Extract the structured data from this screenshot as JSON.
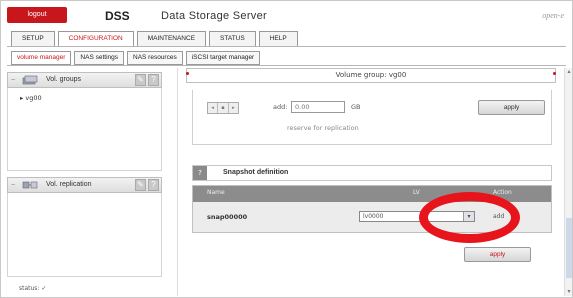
{
  "header": {
    "logout_label": "logout",
    "brand": "DSS",
    "brand_subtitle": "Data Storage Server",
    "vendor": "open-e"
  },
  "main_tabs": [
    {
      "label": "SETUP",
      "active": false
    },
    {
      "label": "CONFIGURATION",
      "active": true
    },
    {
      "label": "MAINTENANCE",
      "active": false
    },
    {
      "label": "STATUS",
      "active": false
    },
    {
      "label": "HELP",
      "active": false
    }
  ],
  "sub_tabs": [
    {
      "label": "volume manager",
      "active": true
    },
    {
      "label": "NAS settings",
      "active": false
    },
    {
      "label": "NAS resources",
      "active": false
    },
    {
      "label": "iSCSI target manager",
      "active": false
    }
  ],
  "left_panels": {
    "vol_groups": {
      "title": "Vol. groups",
      "items": [
        "vg00"
      ]
    },
    "vol_replication": {
      "title": "Vol. replication"
    }
  },
  "volume_group_bar": "Volume group: vg00",
  "replication": {
    "add_label": "add:",
    "add_value": "0.00",
    "unit": "GB",
    "hint": "reserve for replication",
    "apply_label": "apply"
  },
  "snapshot": {
    "section_title": "Snapshot definition",
    "columns": [
      "Name",
      "LV",
      "Action"
    ],
    "rows": [
      {
        "name": "snap00000",
        "lv": "lv0000",
        "action": "add"
      }
    ],
    "apply_label": "apply"
  },
  "status_bar": "status: ✓",
  "colors": {
    "brand_red": "#c8161d",
    "table_header": "#8c8c8c",
    "highlight": "#e8141b"
  }
}
